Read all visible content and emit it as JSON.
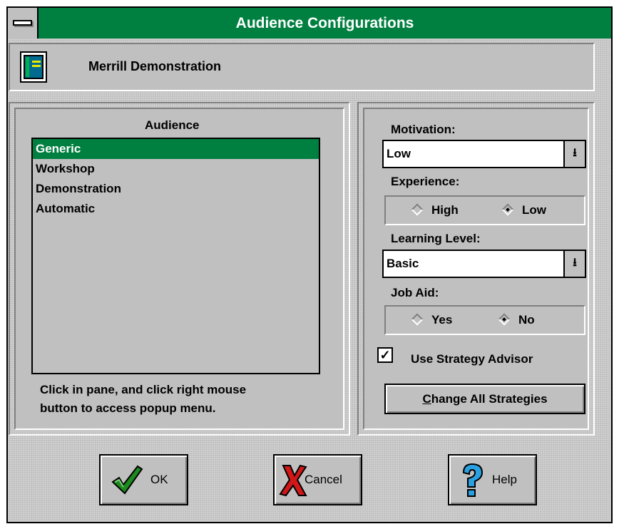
{
  "window": {
    "title": "Audience Configurations"
  },
  "header": {
    "text": "Merrill Demonstration"
  },
  "audience": {
    "label": "Audience",
    "items": [
      "Generic",
      "Workshop",
      "Demonstration",
      "Automatic"
    ],
    "selected": "Generic",
    "hint_line1": "Click in pane, and click right mouse",
    "hint_line2": "button to access popup menu."
  },
  "settings": {
    "motivation": {
      "label": "Motivation:",
      "value": "Low"
    },
    "experience": {
      "label": "Experience:",
      "options": [
        "High",
        "Low"
      ],
      "selected": "Low"
    },
    "learning_level": {
      "label": "Learning Level:",
      "value": "Basic"
    },
    "job_aid": {
      "label": "Job Aid:",
      "options": [
        "Yes",
        "No"
      ],
      "selected": "No"
    },
    "strategy_advisor": {
      "label": "Use Strategy Advisor",
      "checked": true,
      "check_glyph": "✓"
    },
    "change_all": {
      "label_first": "C",
      "label_rest": "hange All Strategies"
    }
  },
  "buttons": {
    "ok": "OK",
    "cancel": "Cancel",
    "help": "Help"
  },
  "icons": {
    "dropdown": "⭳",
    "system_menu": "system-menu-icon"
  },
  "colors": {
    "title_bar": "#008040",
    "selection": "#008040",
    "face": "#c0c0c0"
  }
}
